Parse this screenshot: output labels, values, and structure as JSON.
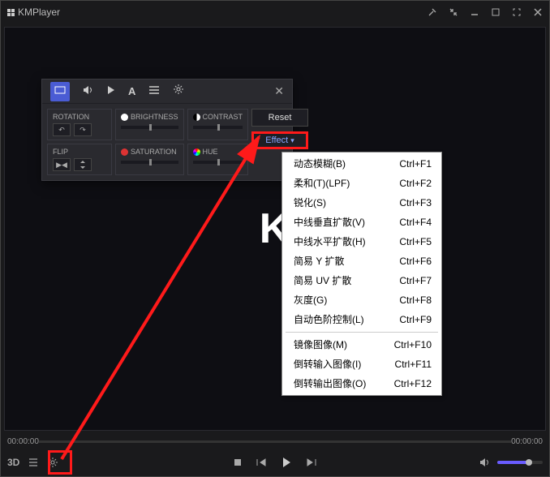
{
  "app": {
    "title": "KMPlayer"
  },
  "times": {
    "elapsed": "00:00:00",
    "left_time": "00:00:00",
    "total": "00:00:00"
  },
  "bottom": {
    "threeD": "3D"
  },
  "panel": {
    "rotation": {
      "label": "ROTATION"
    },
    "flip": {
      "label": "FLIP"
    },
    "brightness": {
      "label": "BRIGHTNESS"
    },
    "contrast": {
      "label": "CONTRAST"
    },
    "saturation": {
      "label": "SATURATION"
    },
    "hue": {
      "label": "HUE"
    },
    "reset": "Reset",
    "effect": "Effect"
  },
  "menu": {
    "items": [
      {
        "label": "动态模糊(B)",
        "shortcut": "Ctrl+F1"
      },
      {
        "label": "柔和(T)(LPF)",
        "shortcut": "Ctrl+F2"
      },
      {
        "label": "锐化(S)",
        "shortcut": "Ctrl+F3"
      },
      {
        "label": "中线垂直扩散(V)",
        "shortcut": "Ctrl+F4"
      },
      {
        "label": "中线水平扩散(H)",
        "shortcut": "Ctrl+F5"
      },
      {
        "label": "简易 Y 扩散",
        "shortcut": "Ctrl+F6"
      },
      {
        "label": "简易 UV 扩散",
        "shortcut": "Ctrl+F7"
      },
      {
        "label": "灰度(G)",
        "shortcut": "Ctrl+F8"
      },
      {
        "label": "自动色阶控制(L)",
        "shortcut": "Ctrl+F9"
      }
    ],
    "items2": [
      {
        "label": "镜像图像(M)",
        "shortcut": "Ctrl+F10"
      },
      {
        "label": "倒转输入图像(I)",
        "shortcut": "Ctrl+F11"
      },
      {
        "label": "倒转输出图像(O)",
        "shortcut": "Ctrl+F12"
      }
    ]
  },
  "logo_text": "K"
}
